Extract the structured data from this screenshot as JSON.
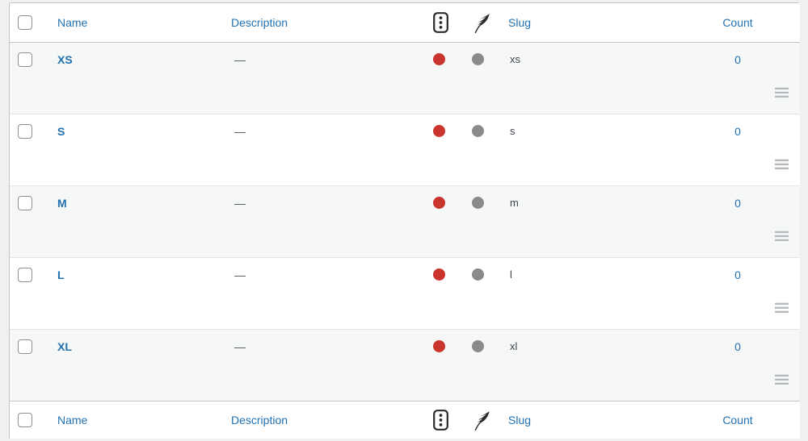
{
  "table": {
    "columns": [
      {
        "key": "cb",
        "label": "",
        "icon": "checkbox-select-all"
      },
      {
        "key": "name",
        "label": "Name"
      },
      {
        "key": "desc",
        "label": "Description"
      },
      {
        "key": "light",
        "label": "",
        "icon": "traffic-light-icon"
      },
      {
        "key": "feat",
        "label": "",
        "icon": "feather-icon"
      },
      {
        "key": "slug",
        "label": "Slug"
      },
      {
        "key": "count",
        "label": "Count"
      }
    ],
    "header": {
      "name": "Name",
      "description": "Description",
      "slug": "Slug",
      "count": "Count"
    },
    "footer": {
      "name": "Name",
      "description": "Description",
      "slug": "Slug",
      "count": "Count"
    },
    "rows": [
      {
        "name": "XS",
        "description": "—",
        "light": "red",
        "feather": "grey",
        "slug": "xs",
        "count": "0",
        "stripe": "alt"
      },
      {
        "name": "S",
        "description": "—",
        "light": "red",
        "feather": "grey",
        "slug": "s",
        "count": "0",
        "stripe": "plain"
      },
      {
        "name": "M",
        "description": "—",
        "light": "red",
        "feather": "grey",
        "slug": "m",
        "count": "0",
        "stripe": "alt"
      },
      {
        "name": "L",
        "description": "—",
        "light": "red",
        "feather": "grey",
        "slug": "l",
        "count": "0",
        "stripe": "plain"
      },
      {
        "name": "XL",
        "description": "—",
        "light": "red",
        "feather": "grey",
        "slug": "xl",
        "count": "0",
        "stripe": "alt"
      }
    ]
  },
  "colors": {
    "link": "#2271b1",
    "text": "#3c434a",
    "dot_red": "#c9342c",
    "dot_grey": "#8a8a8a",
    "row_alt": "#f6f7f7",
    "row_plain": "#ffffff",
    "border": "#c3c4c7",
    "page_bg": "#f0f0f1"
  }
}
